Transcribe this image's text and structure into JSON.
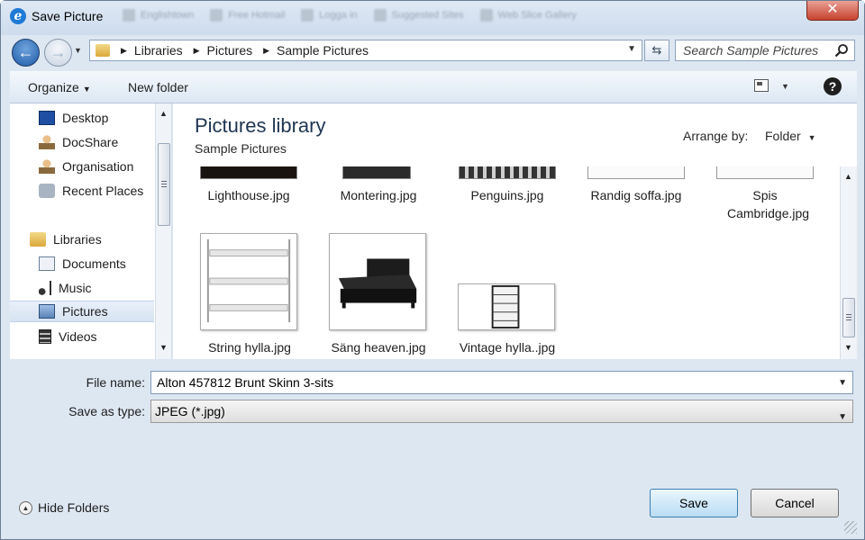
{
  "window": {
    "title": "Save Picture",
    "close_label": "✕",
    "background_tabs": [
      "Englishtown",
      "Free Hotmail",
      "Logga in",
      "Suggested Sites",
      "Web Slice Gallery"
    ]
  },
  "address": {
    "crumbs": [
      "Libraries",
      "Pictures",
      "Sample Pictures"
    ],
    "search_placeholder": "Search Sample Pictures"
  },
  "toolbar": {
    "organize_label": "Organize",
    "new_folder_label": "New folder",
    "help_label": "?"
  },
  "navpane": {
    "items": [
      {
        "label": "Desktop",
        "icon": "desktop-icon"
      },
      {
        "label": "DocShare",
        "icon": "user-folder-icon"
      },
      {
        "label": "Organisation",
        "icon": "user-folder-icon"
      },
      {
        "label": "Recent Places",
        "icon": "recent-places-icon"
      },
      {
        "label": "Libraries",
        "icon": "libraries-icon"
      },
      {
        "label": "Documents",
        "icon": "documents-icon"
      },
      {
        "label": "Music",
        "icon": "music-icon"
      },
      {
        "label": "Pictures",
        "icon": "pictures-icon",
        "selected": true
      },
      {
        "label": "Videos",
        "icon": "videos-icon"
      }
    ]
  },
  "content": {
    "library_title": "Pictures library",
    "library_subtitle": "Sample Pictures",
    "arrange_label": "Arrange by:",
    "arrange_value": "Folder",
    "files_row1": [
      "Lighthouse.jpg",
      "Montering.jpg",
      "Penguins.jpg",
      "Randig soffa.jpg",
      "Spis Cambridge.jpg"
    ],
    "files_row2": [
      "String hylla.jpg",
      "Säng heaven.jpg",
      "Vintage hylla..jpg"
    ]
  },
  "form": {
    "file_name_label": "File name:",
    "file_name_value": "Alton 457812 Brunt Skinn 3-sits",
    "save_as_type_label": "Save as type:",
    "save_as_type_value": "JPEG (*.jpg)"
  },
  "footer": {
    "hide_folders_label": "Hide Folders",
    "save_label": "Save",
    "cancel_label": "Cancel"
  },
  "colors": {
    "frame": "#dde7f2",
    "accent": "#1d5aa8",
    "close": "#c7422e",
    "selection": "#d6e3f2"
  }
}
